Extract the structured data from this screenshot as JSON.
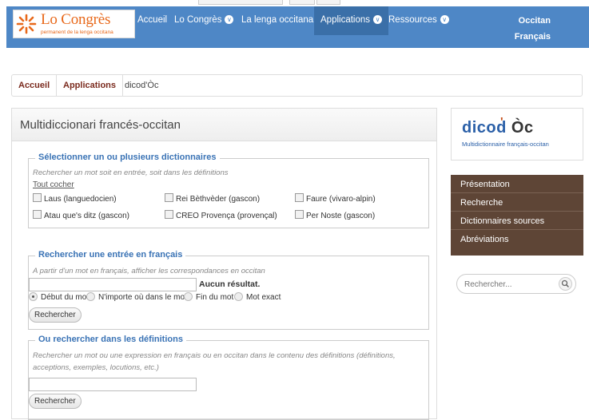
{
  "nav": {
    "logo_title": "Lo Congrès",
    "logo_subtitle": "permanent de la lenga occitana",
    "items": [
      {
        "label": "Accueil"
      },
      {
        "label": "Lo Congrès",
        "chevron": "∨"
      },
      {
        "label": "La lenga occitana"
      },
      {
        "label": "Applications",
        "chevron": "∨"
      },
      {
        "label": "Ressources",
        "chevron": "∨"
      }
    ],
    "lang_1": "Occitan",
    "lang_2": "Français"
  },
  "breadcrumb": [
    "Accueil",
    "Applications",
    "dicod'Òc"
  ],
  "main": {
    "title_1": "Multidiccionari",
    "title_2": " francés-occitan",
    "select": {
      "legend": "Sélectionner un ou plusieurs dictionnaires",
      "hint": "Rechercher un mot soit en entrée, soit dans les définitions",
      "check_all": "Tout cocher",
      "dictionaries": [
        "Laus (languedocien)",
        "Rei Bèthvèder (gascon)",
        "Faure (vivaro-alpin)",
        "Atau que's ditz (gascon)",
        "CREO Provença (provençal)",
        "Per Noste (gascon)"
      ]
    },
    "entry": {
      "legend": "Rechercher une entrée en français",
      "hint": "A partir d'un mot en français, afficher les correspondances en occitan",
      "input_value": "",
      "status": "Aucun résultat.",
      "radios": [
        "Début du mot",
        "N'importe où dans le mot",
        "Fin du mot",
        "Mot exact"
      ],
      "selected_radio": "Début du mot",
      "button": "Rechercher"
    },
    "defs": {
      "legend": "Ou rechercher dans les définitions",
      "hint": "Rechercher un mot ou une expression en français ou en occitan dans le contenu des définitions (définitions, acceptions, exemples, locutions, etc.)",
      "input_value": "",
      "button": "Rechercher"
    }
  },
  "sidebar": {
    "brand_word": "dicod",
    "brand_apos": "'",
    "brand_oc": "Òc",
    "brand_subtitle": "Multidictionnaire français-occitan",
    "menu": [
      "Présentation",
      "Recherche",
      "Dictionnaires sources",
      "Abréviations"
    ],
    "search_placeholder": "Rechercher...",
    "menu_bg": "#5e4536"
  },
  "colors": {
    "navbar": "#4e87c6",
    "logo_orange": "#e8681a",
    "legend_blue": "#3a73b5",
    "crumb_link": "#7a2a1d"
  }
}
